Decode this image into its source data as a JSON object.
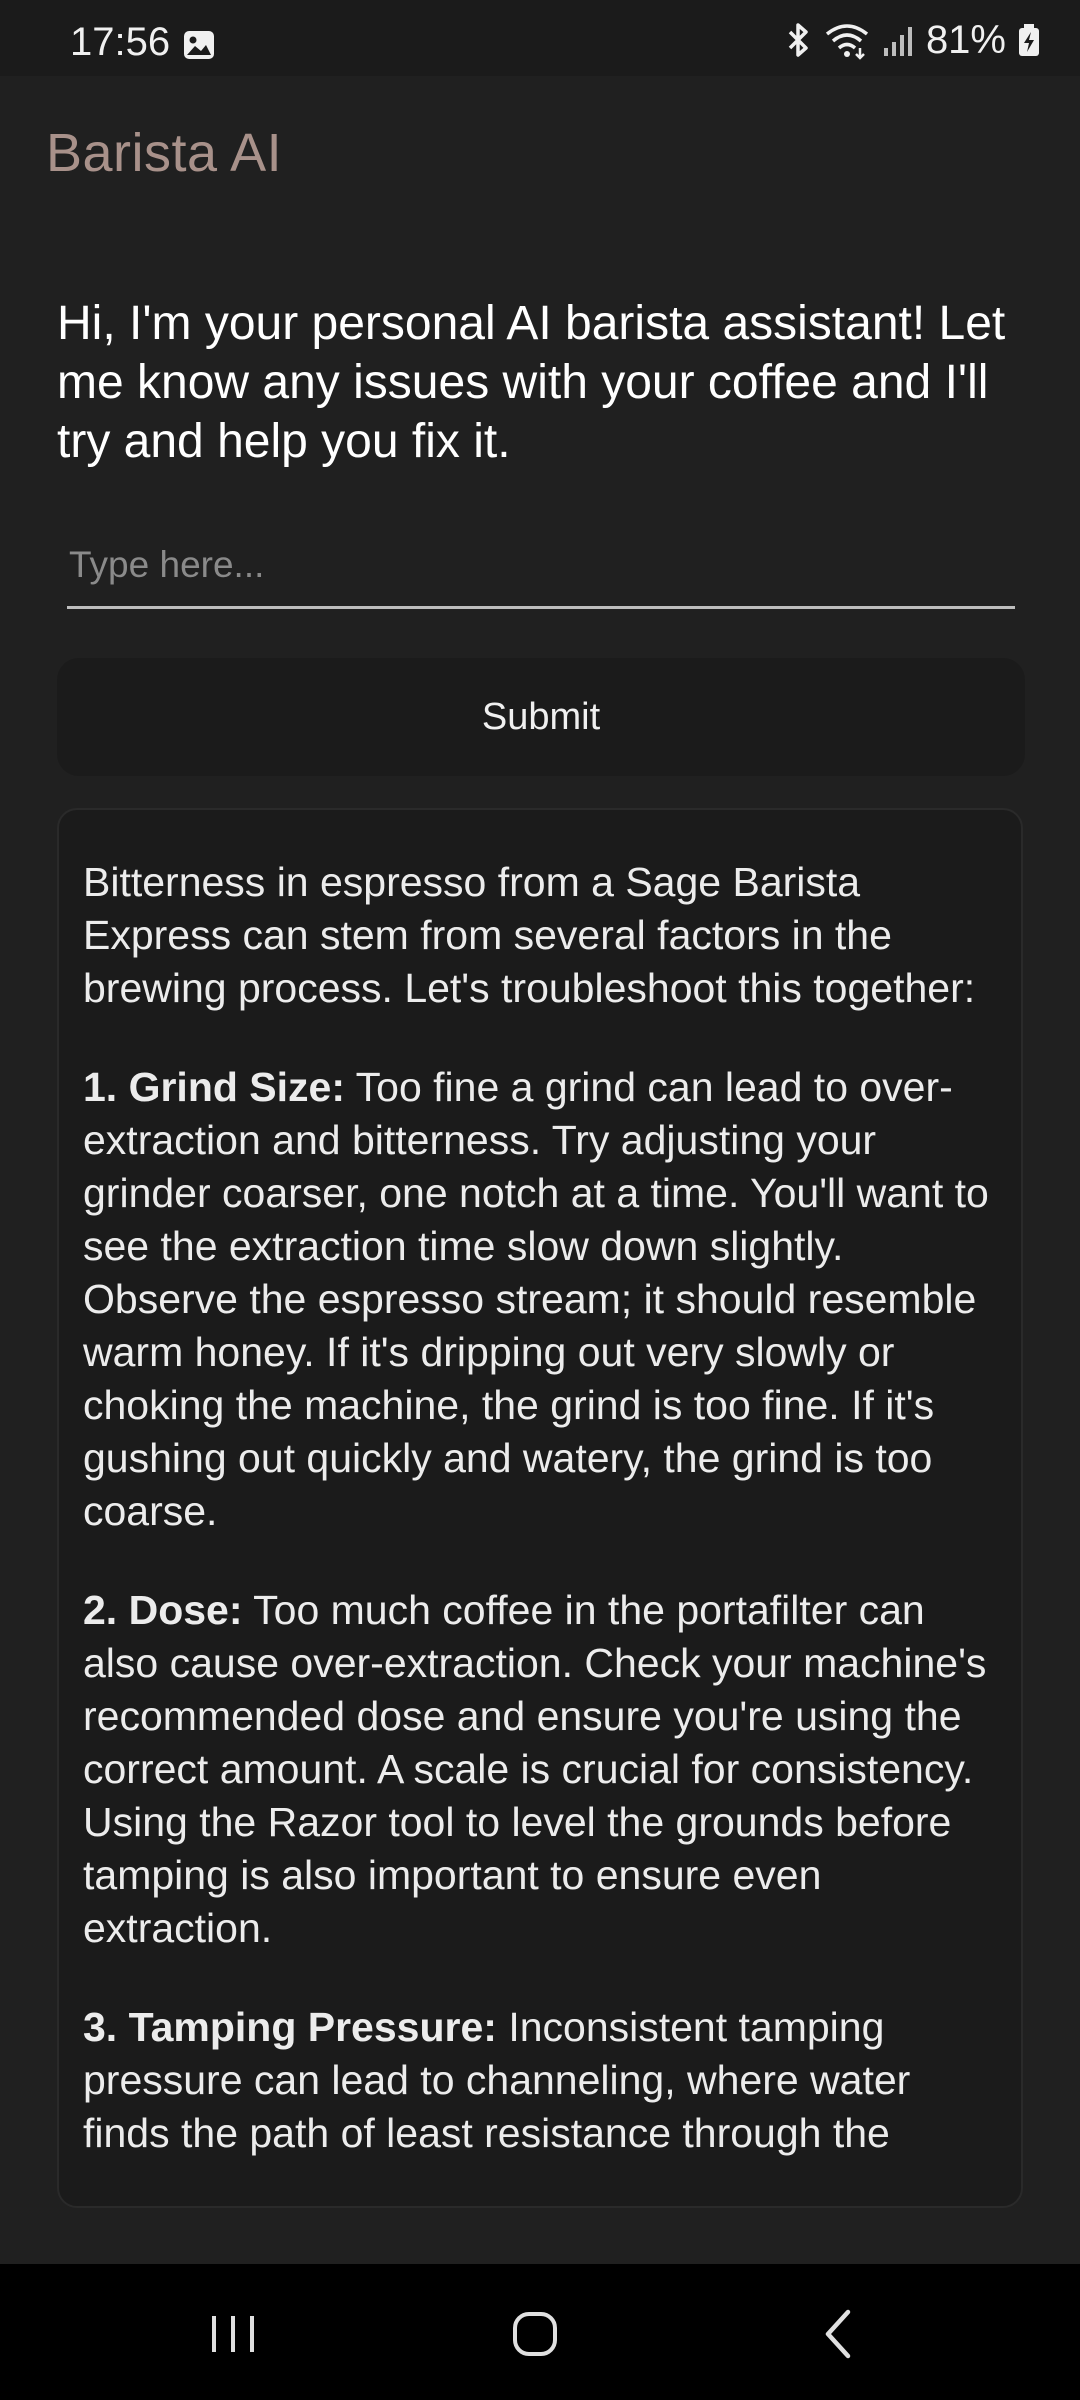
{
  "status_bar": {
    "time": "17:56",
    "battery": "81%",
    "icons": [
      "photo-icon",
      "bluetooth-icon",
      "wifi-icon",
      "signal-icon",
      "battery-charging-icon"
    ]
  },
  "app": {
    "title": "Barista AI",
    "intro": "Hi, I'm your personal AI barista assistant! Let me know any issues with your coffee and I'll try and help you fix it."
  },
  "input": {
    "placeholder": "Type here...",
    "value": ""
  },
  "submit_label": "Submit",
  "response": {
    "intro": "Bitterness in espresso from a Sage Barista Express can stem from several factors in the brewing process. Let's troubleshoot this together:",
    "points": [
      {
        "heading": "1. Grind Size:",
        "text": " Too fine a grind can lead to over-extraction and bitterness. Try adjusting your grinder coarser, one notch at a time. You'll want to see the extraction time slow down slightly. Observe the espresso stream; it should resemble warm honey. If it's dripping out very slowly or choking the machine, the grind is too fine. If it's gushing out quickly and watery, the grind is too coarse."
      },
      {
        "heading": "2. Dose:",
        "text": " Too much coffee in the portafilter can also cause over-extraction. Check your machine's recommended dose and ensure you're using the correct amount. A scale is crucial for consistency. Using the Razor tool to level the grounds before tamping is also important to ensure even extraction."
      },
      {
        "heading": "3. Tamping Pressure:",
        "text": " Inconsistent tamping pressure can lead to channeling, where water finds the path of least resistance through the"
      }
    ]
  },
  "nav": {
    "icons": [
      "recents-icon",
      "home-icon",
      "back-icon"
    ]
  }
}
